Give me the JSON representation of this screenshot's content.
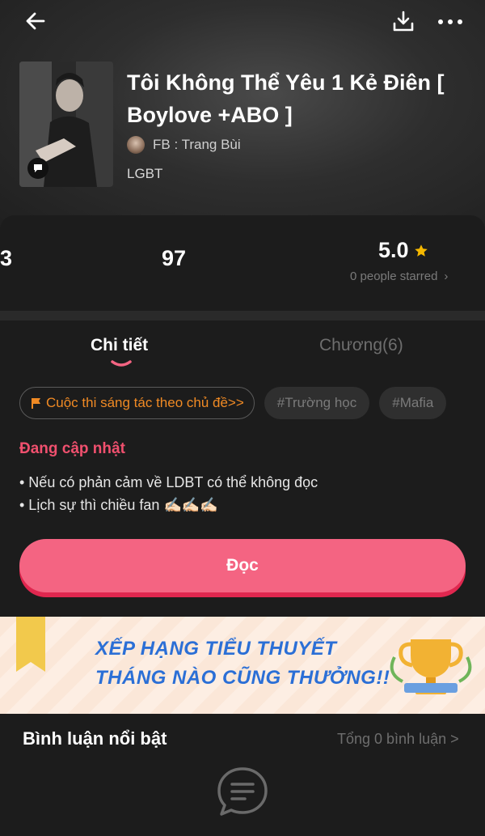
{
  "book": {
    "title": "Tôi Không Thể Yêu 1 Kẻ Điên [ Boylove +ABO ]",
    "author": "FB : Trang Bùi",
    "genre": "LGBT"
  },
  "icons": {
    "back": "arrow-left-icon",
    "download": "download-icon",
    "more": "more-icon",
    "cover_badge": "chat-bubble-icon",
    "star": "star-icon",
    "chevron": "chevron-right-icon",
    "flag": "flag-icon",
    "comment": "comment-icon",
    "trophy": "trophy-icon"
  },
  "stats": {
    "left_value": "3",
    "middle_value": "97",
    "rating": "5.0",
    "rating_sub": "0 people starred",
    "rating_chevron": "›"
  },
  "tabs": {
    "detail": "Chi tiết",
    "chapters": "Chương(6)"
  },
  "chips": [
    "Cuộc thi sáng tác theo chủ đề>>",
    "#Trường học",
    "#Mafia"
  ],
  "status": "Đang cập nhật",
  "description": [
    "• Nếu có phản cảm về LDBT có thể không đọc",
    "• Lịch sự thì chiều fan ✍🏻✍🏻✍🏻"
  ],
  "read_button": "Đọc",
  "banner": {
    "line1": "XẾP HẠNG TIỂU THUYẾT",
    "line2": "THÁNG NÀO CŨNG THƯỞNG!!"
  },
  "comments": {
    "title": "Bình luận nổi bật",
    "total": "Tổng 0 bình luận >"
  },
  "colors": {
    "accent_pink": "#f46482",
    "status_red": "#f0506e",
    "contest_orange": "#f08a24",
    "star_yellow": "#f5b800",
    "banner_blue": "#2b6fd6"
  }
}
